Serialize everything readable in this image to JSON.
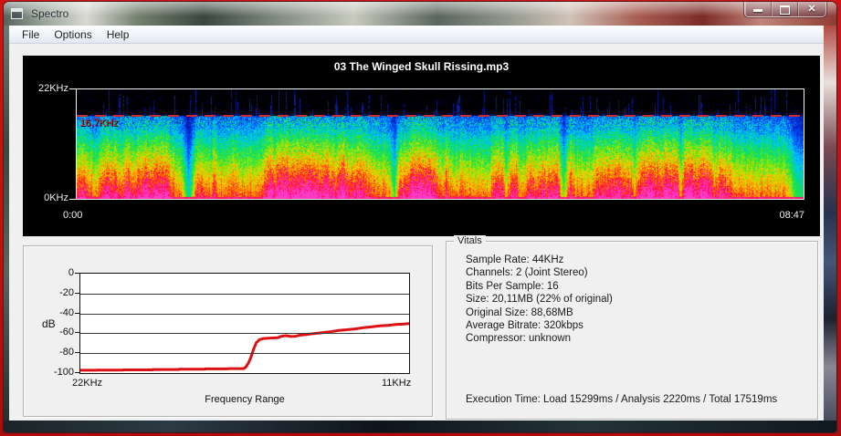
{
  "window": {
    "title": "Spectro",
    "controls": {
      "minimize": "minimize-icon",
      "maximize": "maximize-icon",
      "close_glyph": "x"
    }
  },
  "menu": {
    "items": [
      {
        "label": "File"
      },
      {
        "label": "Options"
      },
      {
        "label": "Help"
      }
    ]
  },
  "spectrogram": {
    "title": "03 The Winged Skull Rissing.mp3",
    "freq_top_label": "22KHz",
    "freq_bottom_label": "0KHz",
    "cutoff_label": "16,7KHz",
    "cutoff_color": "#c62c2c",
    "time_start": "0:00",
    "time_end": "08:47"
  },
  "freq_chart": {
    "ylabel": "dB",
    "yticks": [
      "0",
      "-20",
      "-40",
      "-60",
      "-80",
      "-100"
    ],
    "x_left_label": "22KHz",
    "x_right_label": "11KHz",
    "xlabel": "Frequency Range",
    "line_color": "#dd1111"
  },
  "vitals": {
    "title": "Vitals",
    "lines": [
      "Sample Rate: 44KHz",
      "Channels: 2 (Joint Stereo)",
      "Bits Per Sample: 16",
      "Size: 20,11MB (22% of original)",
      "Original Size: 88,68MB",
      "Average Bitrate: 320kbps",
      "Compressor: unknown"
    ],
    "execution": "Execution Time: Load 15299ms / Analysis 2220ms / Total 17519ms"
  },
  "chart_data": [
    {
      "type": "heatmap",
      "title": "03 The Winged Skull Rissing.mp3",
      "x_range": [
        "0:00",
        "08:47"
      ],
      "ylabel_range_khz": [
        0,
        22
      ],
      "cutoff_line_khz": 16.7,
      "description": "Audio spectrogram: high energy (red/magenta) at low frequencies grading through orange, green and cyan with sharp lowpass cutoff at 16.7KHz marked by red dashed line; sparse blue transient spikes above cutoff up to 22KHz"
    },
    {
      "type": "line",
      "title": "Frequency Range",
      "ylabel": "dB",
      "ylim": [
        -100,
        0
      ],
      "yticks": [
        0,
        -20,
        -40,
        -60,
        -80,
        -100
      ],
      "x_axis_labels": [
        "22KHz",
        "11KHz"
      ],
      "legend": [],
      "grid": true,
      "points": [
        [
          0,
          -97.2
        ],
        [
          0.05,
          -97.2
        ],
        [
          0.05,
          -97
        ],
        [
          0.13,
          -97
        ],
        [
          0.13,
          -96.8
        ],
        [
          0.22,
          -96.8
        ],
        [
          0.22,
          -96.4
        ],
        [
          0.3,
          -96.4
        ],
        [
          0.3,
          -96.1
        ],
        [
          0.38,
          -96.1
        ],
        [
          0.38,
          -95.8
        ],
        [
          0.45,
          -95.8
        ],
        [
          0.45,
          -95.5
        ],
        [
          0.497,
          -95.5
        ],
        [
          0.503,
          -94
        ],
        [
          0.511,
          -90
        ],
        [
          0.519,
          -84
        ],
        [
          0.527,
          -76
        ],
        [
          0.535,
          -69.5
        ],
        [
          0.545,
          -66.3
        ],
        [
          0.558,
          -65.2
        ],
        [
          0.58,
          -64.8
        ],
        [
          0.6,
          -64.5
        ],
        [
          0.613,
          -62.8
        ],
        [
          0.627,
          -62.4
        ],
        [
          0.64,
          -63.2
        ],
        [
          0.655,
          -62.9
        ],
        [
          0.668,
          -61.8
        ],
        [
          0.69,
          -61.2
        ],
        [
          0.71,
          -60.3
        ],
        [
          0.735,
          -59.4
        ],
        [
          0.76,
          -58.4
        ],
        [
          0.785,
          -57.2
        ],
        [
          0.81,
          -56.4
        ],
        [
          0.835,
          -55.6
        ],
        [
          0.86,
          -54.4
        ],
        [
          0.885,
          -53.6
        ],
        [
          0.91,
          -52.6
        ],
        [
          0.935,
          -52
        ],
        [
          0.96,
          -51.2
        ],
        [
          0.98,
          -50.8
        ],
        [
          1,
          -50.3
        ]
      ]
    }
  ]
}
